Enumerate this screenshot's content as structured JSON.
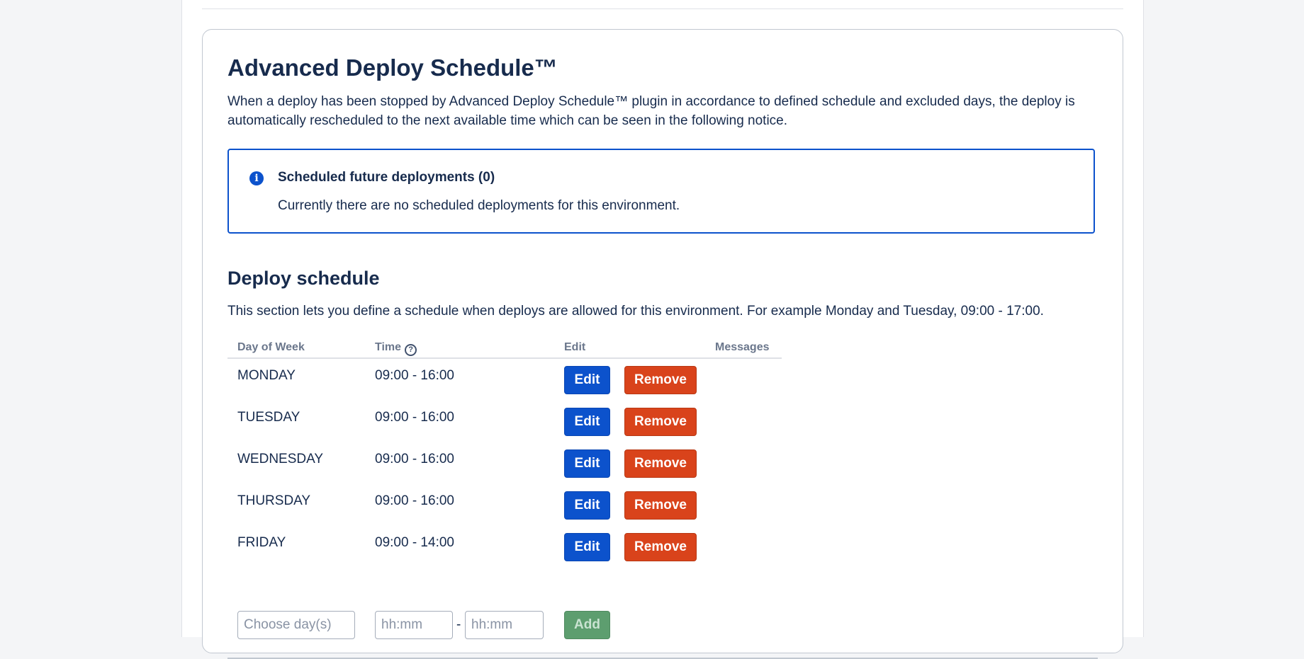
{
  "plugin": {
    "title": "Advanced Deploy Schedule™",
    "intro": "When a deploy has been stopped by Advanced Deploy Schedule™ plugin in accordance to defined schedule and excluded days, the deploy is automatically rescheduled to the next available time which can be seen in the following notice."
  },
  "notice": {
    "icon": "info-icon",
    "title": "Scheduled future deployments (0)",
    "body": "Currently there are no scheduled deployments for this environment."
  },
  "schedule": {
    "title": "Deploy schedule",
    "description": "This section lets you define a schedule when deploys are allowed for this environment. For example Monday and Tuesday, 09:00 - 17:00.",
    "columns": {
      "day": "Day of Week",
      "time": "Time",
      "edit": "Edit",
      "messages": "Messages"
    },
    "rows": [
      {
        "day": "MONDAY",
        "time": "09:00 - 16:00"
      },
      {
        "day": "TUESDAY",
        "time": "09:00 - 16:00"
      },
      {
        "day": "WEDNESDAY",
        "time": "09:00 - 16:00"
      },
      {
        "day": "THURSDAY",
        "time": "09:00 - 16:00"
      },
      {
        "day": "FRIDAY",
        "time": "09:00 - 14:00"
      }
    ],
    "edit_label": "Edit",
    "remove_label": "Remove",
    "add_form": {
      "day_placeholder": "Choose day(s)",
      "from_placeholder": "hh:mm",
      "to_placeholder": "hh:mm",
      "separator": "-",
      "add_label": "Add"
    }
  },
  "colors": {
    "primary": "#0c52cc",
    "danger": "#d9431b",
    "success": "#5d9e6f"
  }
}
